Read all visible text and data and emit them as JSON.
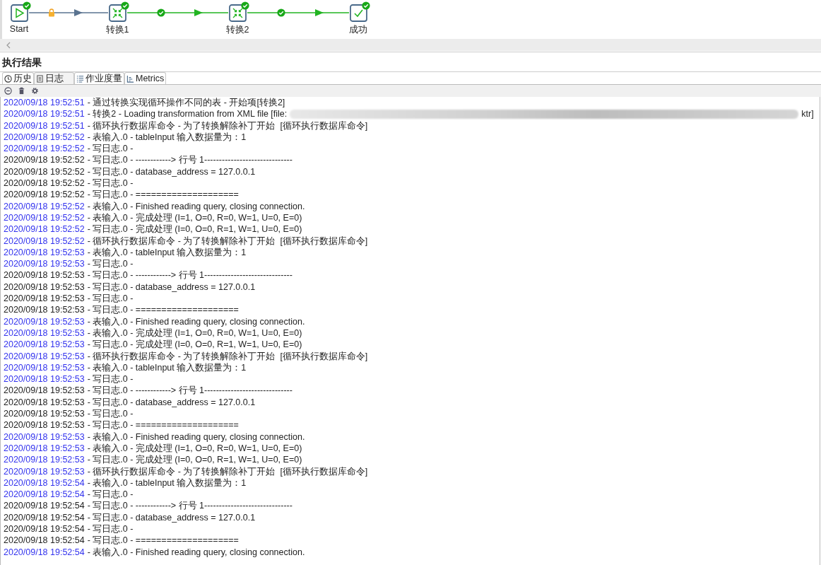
{
  "flow": {
    "nodes": [
      {
        "label": "Start",
        "kind": "start",
        "done": true
      },
      {
        "label": "转换1",
        "kind": "transform",
        "done": true
      },
      {
        "label": "转换2",
        "kind": "transform",
        "done": true
      },
      {
        "label": "成功",
        "kind": "success",
        "done": true
      }
    ],
    "hops": [
      {
        "kind": "locked"
      },
      {
        "kind": "success"
      },
      {
        "kind": "success"
      }
    ]
  },
  "results": {
    "title": "执行结果",
    "tabs": [
      {
        "label": "历史",
        "selected": false
      },
      {
        "label": "日志",
        "selected": true
      },
      {
        "label": "作业度量",
        "selected": false
      },
      {
        "label": "Metrics",
        "selected": false
      }
    ],
    "log": [
      {
        "time": "2020/09/18 19:52:51",
        "text": "- 通过转换实现循环操作不同的表 - 开始项[转换2]",
        "color": "#3333ee"
      },
      {
        "time": "2020/09/18 19:52:51",
        "text": "- 转换2 - Loading transformation from XML file [file:",
        "tail": "ktr]",
        "redacted": true,
        "color": "#3333ee"
      },
      {
        "time": "2020/09/18 19:52:51",
        "text": "- 循环执行数据库命令 - 为了转换解除补丁开始  [循环执行数据库命令]",
        "color": "#3333ee"
      },
      {
        "time": "2020/09/18 19:52:52",
        "text": "- 表输入.0 - tableInput 输入数据量为：1",
        "color": "#3333ee"
      },
      {
        "time": "2020/09/18 19:52:52",
        "text": "- 写日志.0 -",
        "color": "#3333ee"
      },
      {
        "time": "2020/09/18 19:52:52",
        "text": "- 写日志.0 - ------------> 行号 1------------------------------",
        "color": "#222222"
      },
      {
        "time": "2020/09/18 19:52:52",
        "text": "- 写日志.0 - database_address = 127.0.0.1",
        "color": "#222222"
      },
      {
        "time": "2020/09/18 19:52:52",
        "text": "- 写日志.0 -",
        "color": "#222222"
      },
      {
        "time": "2020/09/18 19:52:52",
        "text": "- 写日志.0 - ====================",
        "color": "#222222"
      },
      {
        "time": "2020/09/18 19:52:52",
        "text": "- 表输入.0 - Finished reading query, closing connection.",
        "color": "#3333ee"
      },
      {
        "time": "2020/09/18 19:52:52",
        "text": "- 表输入.0 - 完成处理 (I=1, O=0, R=0, W=1, U=0, E=0)",
        "color": "#3333ee"
      },
      {
        "time": "2020/09/18 19:52:52",
        "text": "- 写日志.0 - 完成处理 (I=0, O=0, R=1, W=1, U=0, E=0)",
        "color": "#3333ee"
      },
      {
        "time": "2020/09/18 19:52:52",
        "text": "- 循环执行数据库命令 - 为了转换解除补丁开始  [循环执行数据库命令]",
        "color": "#3333ee"
      },
      {
        "time": "2020/09/18 19:52:53",
        "text": "- 表输入.0 - tableInput 输入数据量为：1",
        "color": "#3333ee"
      },
      {
        "time": "2020/09/18 19:52:53",
        "text": "- 写日志.0 -",
        "color": "#3333ee"
      },
      {
        "time": "2020/09/18 19:52:53",
        "text": "- 写日志.0 - ------------> 行号 1------------------------------",
        "color": "#222222"
      },
      {
        "time": "2020/09/18 19:52:53",
        "text": "- 写日志.0 - database_address = 127.0.0.1",
        "color": "#222222"
      },
      {
        "time": "2020/09/18 19:52:53",
        "text": "- 写日志.0 -",
        "color": "#222222"
      },
      {
        "time": "2020/09/18 19:52:53",
        "text": "- 写日志.0 - ====================",
        "color": "#222222"
      },
      {
        "time": "2020/09/18 19:52:53",
        "text": "- 表输入.0 - Finished reading query, closing connection.",
        "color": "#3333ee"
      },
      {
        "time": "2020/09/18 19:52:53",
        "text": "- 表输入.0 - 完成处理 (I=1, O=0, R=0, W=1, U=0, E=0)",
        "color": "#3333ee"
      },
      {
        "time": "2020/09/18 19:52:53",
        "text": "- 写日志.0 - 完成处理 (I=0, O=0, R=1, W=1, U=0, E=0)",
        "color": "#3333ee"
      },
      {
        "time": "2020/09/18 19:52:53",
        "text": "- 循环执行数据库命令 - 为了转换解除补丁开始  [循环执行数据库命令]",
        "color": "#3333ee"
      },
      {
        "time": "2020/09/18 19:52:53",
        "text": "- 表输入.0 - tableInput 输入数据量为：1",
        "color": "#3333ee"
      },
      {
        "time": "2020/09/18 19:52:53",
        "text": "- 写日志.0 -",
        "color": "#3333ee"
      },
      {
        "time": "2020/09/18 19:52:53",
        "text": "- 写日志.0 - ------------> 行号 1------------------------------",
        "color": "#222222"
      },
      {
        "time": "2020/09/18 19:52:53",
        "text": "- 写日志.0 - database_address = 127.0.0.1",
        "color": "#222222"
      },
      {
        "time": "2020/09/18 19:52:53",
        "text": "- 写日志.0 -",
        "color": "#222222"
      },
      {
        "time": "2020/09/18 19:52:53",
        "text": "- 写日志.0 - ====================",
        "color": "#222222"
      },
      {
        "time": "2020/09/18 19:52:53",
        "text": "- 表输入.0 - Finished reading query, closing connection.",
        "color": "#3333ee"
      },
      {
        "time": "2020/09/18 19:52:53",
        "text": "- 表输入.0 - 完成处理 (I=1, O=0, R=0, W=1, U=0, E=0)",
        "color": "#3333ee"
      },
      {
        "time": "2020/09/18 19:52:53",
        "text": "- 写日志.0 - 完成处理 (I=0, O=0, R=1, W=1, U=0, E=0)",
        "color": "#3333ee"
      },
      {
        "time": "2020/09/18 19:52:53",
        "text": "- 循环执行数据库命令 - 为了转换解除补丁开始  [循环执行数据库命令]",
        "color": "#3333ee"
      },
      {
        "time": "2020/09/18 19:52:54",
        "text": "- 表输入.0 - tableInput 输入数据量为：1",
        "color": "#3333ee"
      },
      {
        "time": "2020/09/18 19:52:54",
        "text": "- 写日志.0 -",
        "color": "#3333ee"
      },
      {
        "time": "2020/09/18 19:52:54",
        "text": "- 写日志.0 - ------------> 行号 1------------------------------",
        "color": "#222222"
      },
      {
        "time": "2020/09/18 19:52:54",
        "text": "- 写日志.0 - database_address = 127.0.0.1",
        "color": "#222222"
      },
      {
        "time": "2020/09/18 19:52:54",
        "text": "- 写日志.0 -",
        "color": "#222222"
      },
      {
        "time": "2020/09/18 19:52:54",
        "text": "- 写日志.0 - ====================",
        "color": "#222222"
      },
      {
        "time": "2020/09/18 19:52:54",
        "text": "- 表输入.0 - Finished reading query, closing connection.",
        "color": "#3333ee"
      }
    ]
  }
}
